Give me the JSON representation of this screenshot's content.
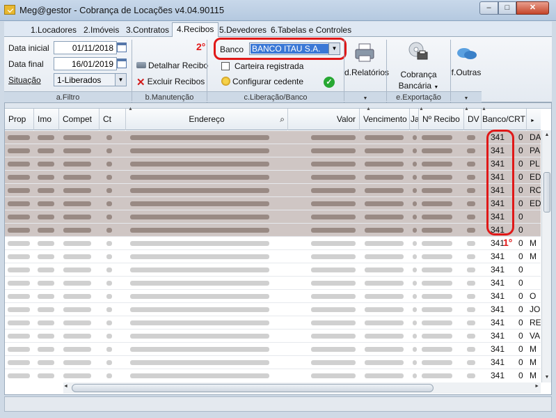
{
  "window": {
    "title": "Meg@gestor - Cobrança de Locações v4.04.90115",
    "minimize": "–",
    "maximize": "□",
    "close": "✕"
  },
  "tabs": [
    "1.Locadores",
    "2.Imóveis",
    "3.Contratos",
    "4.Recibos",
    "5.Devedores",
    "6.Tabelas e Controles"
  ],
  "active_tab": "4.Recibos",
  "filtro": {
    "data_inicial_label": "Data inicial",
    "data_inicial": "01/11/2018",
    "data_final_label": "Data final",
    "data_final": "16/01/2019",
    "situacao_label": "Situação",
    "situacao": "1-Liberados",
    "group_label": "a.Filtro"
  },
  "manutencao": {
    "detalhar": "Detalhar Recibo",
    "excluir": "Excluir Recibos",
    "group_label": "b.Manutenção"
  },
  "liberacao": {
    "banco_label": "Banco",
    "banco_value": "BANCO ITAU S.A.",
    "carteira": "Carteira registrada",
    "configurar": "Configurar cedente",
    "group_label": "c.Liberação/Banco",
    "annotation": "2°"
  },
  "relatorios": {
    "label": "d.Relatórios"
  },
  "exportacao": {
    "label1": "Cobrança",
    "label2": "Bancária",
    "group_label": "e.Exportação"
  },
  "outras": {
    "label": "f.Outras"
  },
  "grid": {
    "columns": [
      "Prop",
      "Imo",
      "Compet",
      "Ct",
      "Endereço",
      "Valor",
      "Vencimento",
      "Jar",
      "Nº Recibo",
      "DV",
      "Banco/CRT",
      ""
    ],
    "rows_banco": [
      "341",
      "341",
      "341",
      "341",
      "341",
      "341",
      "341",
      "341",
      "341",
      "341",
      "341",
      "341",
      "341",
      "341",
      "341",
      "341",
      "341",
      "341",
      "341"
    ],
    "rows_crt": [
      "0",
      "0",
      "0",
      "0",
      "0",
      "0",
      "0",
      "0",
      "0",
      "0",
      "0",
      "0",
      "0",
      "0",
      "0",
      "0",
      "0",
      "0",
      "0"
    ],
    "rows_last": [
      "DA",
      "PA",
      "PL",
      "ED",
      "RO",
      "ED",
      "",
      "",
      "M",
      "M",
      "",
      "",
      "O",
      "JO",
      "RE",
      "VA",
      "M",
      "M",
      "M"
    ],
    "annotation": "1°"
  },
  "colors": {
    "annotation": "#e01818",
    "selection": "#3a78d6"
  }
}
